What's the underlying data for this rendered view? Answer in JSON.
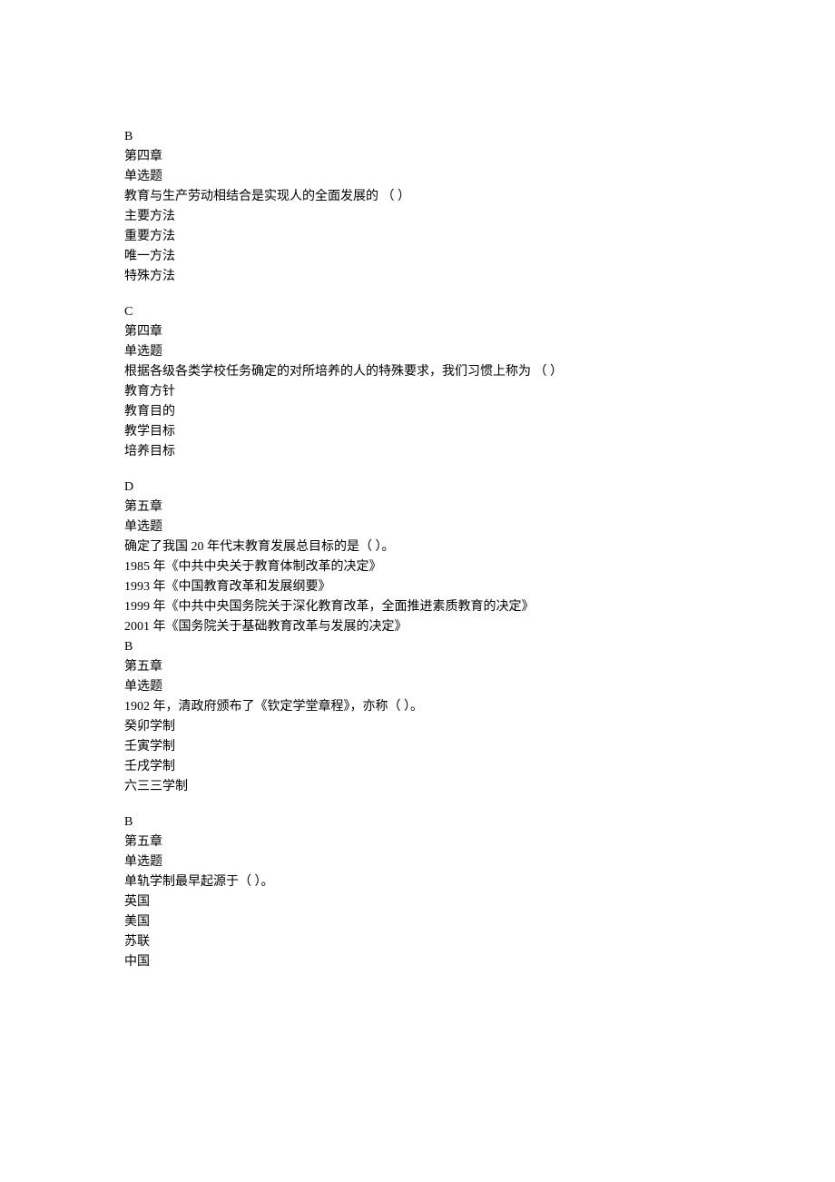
{
  "blocks": [
    {
      "lines": [
        "B",
        "第四章",
        "单选题",
        "教育与生产劳动相结合是实现人的全面发展的 （ ）",
        "主要方法",
        "重要方法",
        "唯一方法",
        "特殊方法"
      ]
    },
    {
      "lines": [
        "C",
        "第四章",
        "单选题",
        "根据各级各类学校任务确定的对所培养的人的特殊要求，我们习惯上称为 （ ）",
        "教育方针",
        "教育目的",
        "教学目标",
        "培养目标"
      ]
    },
    {
      "lines": [
        "D",
        "第五章",
        "单选题",
        "确定了我国 20 年代末教育发展总目标的是（     ）。",
        "1985 年《中共中央关于教育体制改革的决定》",
        "1993 年《中国教育改革和发展纲要》",
        "1999 年《中共中央国务院关于深化教育改革，全面推进素质教育的决定》",
        "2001 年《国务院关于基础教育改革与发展的决定》",
        "B",
        "第五章",
        "单选题",
        "1902 年，清政府颁布了《钦定学堂章程》，亦称（           ）。",
        "癸卯学制",
        "壬寅学制",
        "壬戌学制",
        "六三三学制"
      ]
    },
    {
      "lines": [
        "B",
        "第五章",
        "单选题",
        "单轨学制最早起源于（     ）。",
        "英国",
        "美国",
        "苏联",
        "中国"
      ]
    }
  ]
}
